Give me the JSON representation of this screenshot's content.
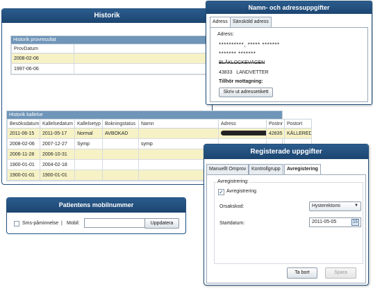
{
  "historik": {
    "title": "Historik",
    "prov_header": "Historik provresultat",
    "prov_columns": [
      "ProvDatum"
    ],
    "prov_rows": [
      "2008-02-06",
      "1997-06-06"
    ],
    "kallelse_header": "Historik kallelse",
    "columns": [
      "Besöksdatum",
      "Kallelsedatum",
      "Kallelsetyp",
      "Bokningstatus",
      "Namn",
      "Adress",
      "Postnr",
      "Postort"
    ],
    "rows": [
      [
        "2011-06-15",
        "2011-05-17",
        "Normal",
        "AVBOKAD",
        "",
        "",
        "42835",
        "KÄLLERED"
      ],
      [
        "2008-02-06",
        "2007-12-27",
        "Symp",
        "",
        "symp",
        "",
        "",
        ""
      ],
      [
        "2006-11-28",
        "2006-10-31",
        "",
        "",
        "",
        "",
        "",
        ""
      ],
      [
        "1900-01-01",
        "2004-02-18",
        "",
        "",
        "",
        "",
        "",
        ""
      ],
      [
        "1900-01-01",
        "1900-01-01",
        "",
        "",
        "",
        "",
        "",
        ""
      ]
    ]
  },
  "namn": {
    "title": "Namn- och adressuppgifter",
    "tabs": [
      "Adress",
      "Sänsköld adress"
    ],
    "address_label": "Adress:",
    "line1": "**********, ***** *******",
    "line2": "******* *******",
    "street": "BLÅKLOCKEVÄGEN",
    "city": "43833   LANDVETTER",
    "mottagning_label": "Tillhör mottagning:",
    "print_button": "Skriv ut adressetikett"
  },
  "mobil": {
    "title": "Patientens mobilnummer",
    "sms_label": "Sms-påminnelse",
    "sep": "|",
    "mobil_label": "Mobil:",
    "mobil_value": "",
    "update_button": "Uppdatera"
  },
  "registrerade": {
    "title": "Registerade uppgifter",
    "tabs": [
      "Manuellt Omprov",
      "Kontrollgrupp",
      "Avregistering"
    ],
    "group_label": "Avregistrering:",
    "checkbox_label": "Avregistrering",
    "checkbox_checked": true,
    "orsak_label": "Orsakskod:",
    "orsak_value": "Hysterektomi",
    "start_label": "Startdatum:",
    "start_value": "2011-05-05",
    "delete_button": "Ta bort",
    "save_button": "Spara"
  }
}
